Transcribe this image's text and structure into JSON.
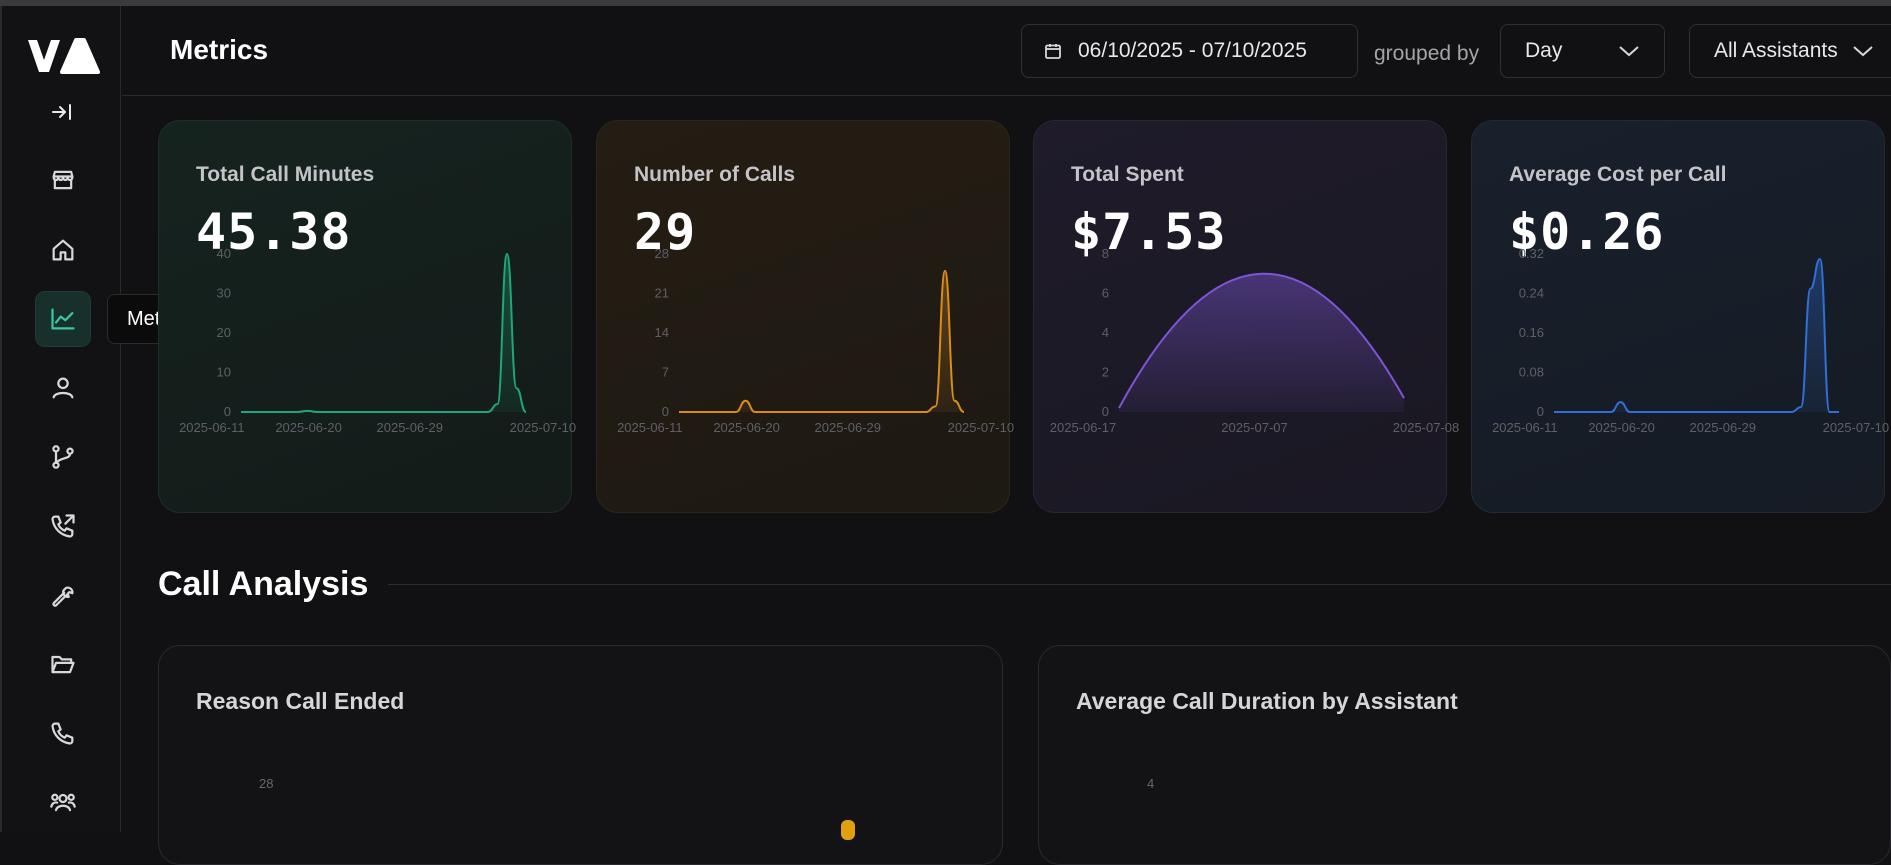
{
  "header": {
    "title": "Metrics",
    "date_range": "06/10/2025 - 07/10/2025",
    "grouped_by_label": "grouped by",
    "group_select": "Day",
    "assistant_select": "All Assistants"
  },
  "sidebar": {
    "tooltip": "Metrics",
    "items": [
      {
        "icon": "store-icon"
      },
      {
        "icon": "home-icon"
      },
      {
        "icon": "chart-icon",
        "active": true
      },
      {
        "icon": "user-icon"
      },
      {
        "icon": "branch-icon"
      },
      {
        "icon": "phone-outgoing-icon"
      },
      {
        "icon": "wrench-icon"
      },
      {
        "icon": "folder-icon"
      },
      {
        "icon": "phone-icon"
      },
      {
        "icon": "users-icon"
      }
    ]
  },
  "colors": {
    "green": "#1ea877",
    "orange": "#d98b1c",
    "purple": "#7d55d6",
    "blue": "#2f6fd6",
    "accent": "#3dc5a4"
  },
  "cards": [
    {
      "title": "Total Call Minutes",
      "value": "45.38"
    },
    {
      "title": "Number of Calls",
      "value": "29"
    },
    {
      "title": "Total Spent",
      "value": "$7.53"
    },
    {
      "title": "Average Cost per Call",
      "value": "$0.26"
    }
  ],
  "chart_data": [
    {
      "type": "area",
      "title": "Total Call Minutes",
      "yticks": [
        "0",
        "10",
        "20",
        "30",
        "40"
      ],
      "ylim": [
        0,
        40
      ],
      "xticks": [
        "2025-06-11",
        "2025-06-20",
        "2025-06-29",
        "2025-07-10"
      ],
      "series": [
        {
          "values": [
            0,
            0,
            0,
            0,
            0,
            0,
            0,
            0.3,
            0,
            0,
            0,
            0,
            0,
            0,
            0,
            0,
            0,
            0,
            0,
            0,
            0,
            0,
            0,
            0,
            0,
            0,
            0,
            2,
            40,
            6,
            0
          ]
        }
      ]
    },
    {
      "type": "area",
      "title": "Number of Calls",
      "yticks": [
        "0",
        "7",
        "14",
        "21",
        "28"
      ],
      "ylim": [
        0,
        28
      ],
      "xticks": [
        "2025-06-11",
        "2025-06-20",
        "2025-06-29",
        "2025-07-10"
      ],
      "series": [
        {
          "values": [
            0,
            0,
            0,
            0,
            0,
            0,
            0,
            2,
            0,
            0,
            0,
            0,
            0,
            0,
            0,
            0,
            0,
            0,
            0,
            0,
            0,
            0,
            0,
            0,
            0,
            0,
            0,
            1,
            25,
            2,
            0
          ]
        }
      ]
    },
    {
      "type": "area",
      "title": "Total Spent",
      "yticks": [
        "0",
        "2",
        "4",
        "6",
        "8"
      ],
      "ylim": [
        0,
        8
      ],
      "xticks": [
        "2025-06-17",
        "2025-07-07",
        "2025-07-08"
      ],
      "series": [
        {
          "values": [
            0.2,
            7,
            0.7
          ]
        }
      ]
    },
    {
      "type": "area",
      "title": "Average Cost per Call",
      "yticks": [
        "0",
        "0.08",
        "0.16",
        "0.24",
        "0.32"
      ],
      "ylim": [
        0,
        0.32
      ],
      "xticks": [
        "2025-06-11",
        "2025-06-20",
        "2025-06-29",
        "2025-07-10"
      ],
      "series": [
        {
          "values": [
            0,
            0,
            0,
            0,
            0,
            0,
            0,
            0.02,
            0,
            0,
            0,
            0,
            0,
            0,
            0,
            0,
            0,
            0,
            0,
            0,
            0,
            0,
            0,
            0,
            0,
            0,
            0.01,
            0.25,
            0.31,
            0,
            0
          ]
        }
      ]
    }
  ],
  "section": {
    "title": "Call Analysis",
    "panel_left_title": "Reason Call Ended",
    "panel_left_tick": "28",
    "panel_right_title": "Average Call Duration by Assistant",
    "panel_right_tick": "4"
  }
}
